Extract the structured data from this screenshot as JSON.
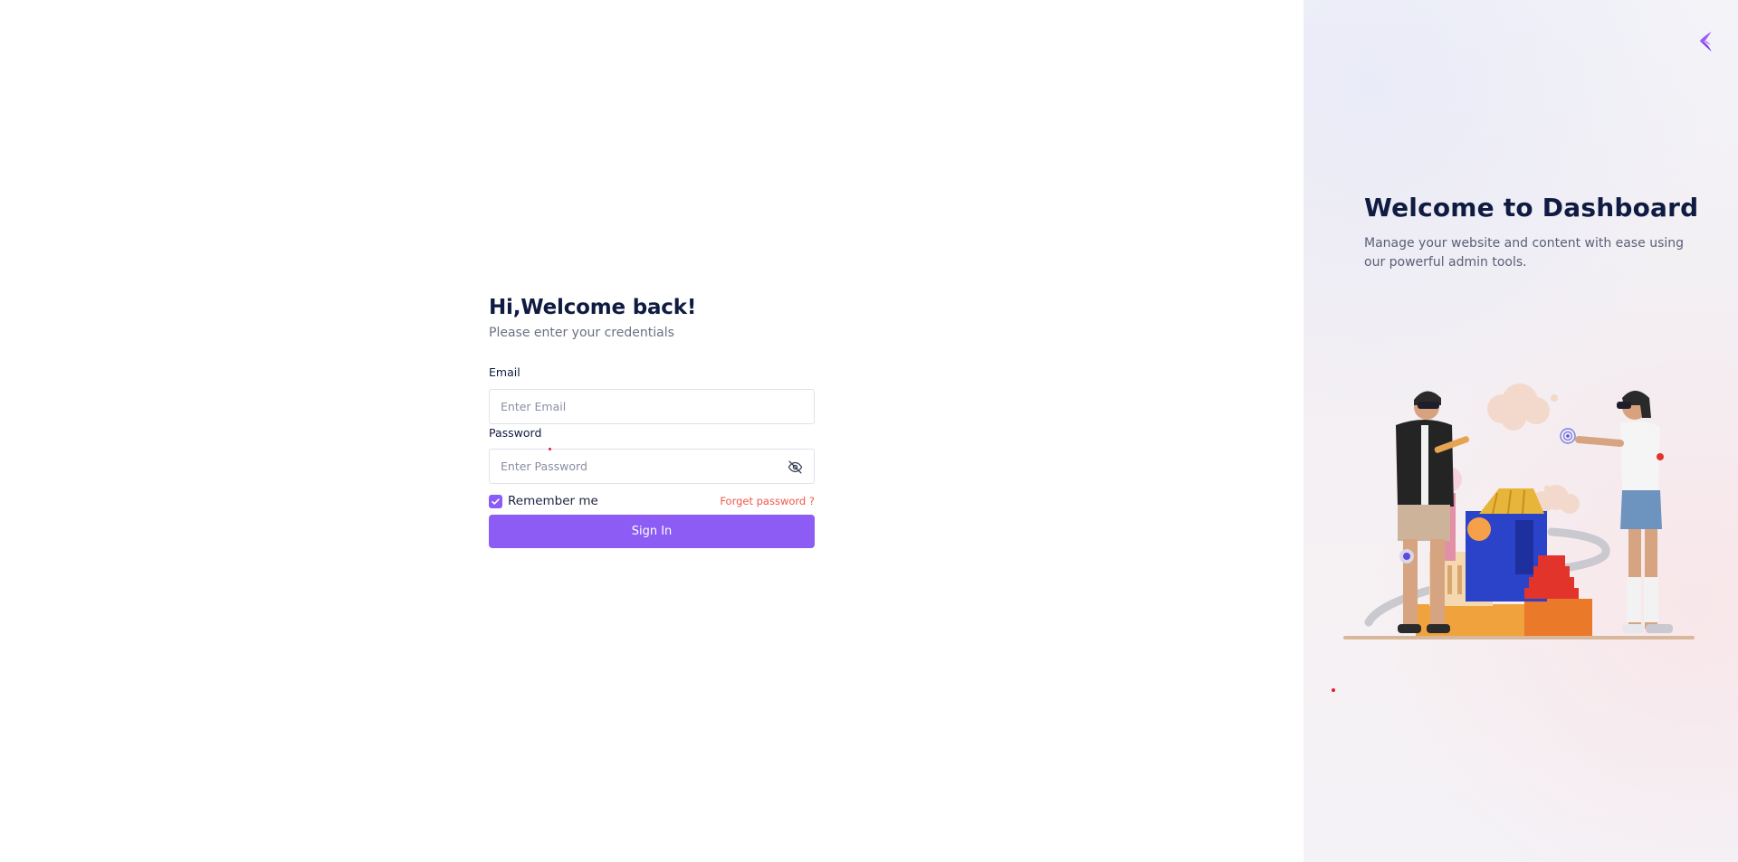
{
  "login": {
    "greeting": "Hi,Welcome back!",
    "subtitle": "Please enter your credentials",
    "email_label": "Email",
    "email_placeholder": "Enter Email",
    "email_value": "",
    "password_label": "Password",
    "password_placeholder": "Enter Password",
    "password_value": "",
    "password_toggle_icon": "eye-off-icon",
    "remember_label": "Remember me",
    "remember_checked": true,
    "forgot_label": "Forget password ?",
    "signin_label": "Sign In"
  },
  "promo": {
    "logo_icon": "brand-logo-icon",
    "title": "Welcome to Dashboard",
    "description": "Manage your website and content with ease using our powerful admin tools.",
    "illustration": "3d-people-building-illustration"
  },
  "colors": {
    "primary": "#8c5cf5",
    "heading": "#0f1b40",
    "muted": "#6b7183",
    "link_danger": "#f0574a",
    "panel_bg": "#f3f2f7"
  }
}
